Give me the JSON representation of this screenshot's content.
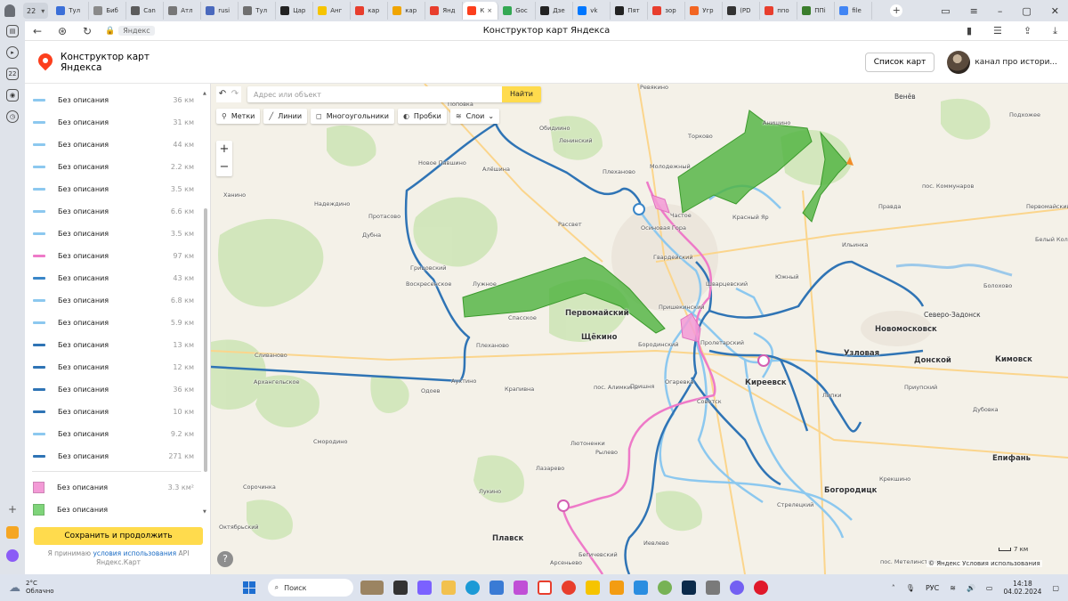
{
  "browser": {
    "tab_counter": "22",
    "tabs": [
      {
        "label": "Тул",
        "color": "#3b6fd8"
      },
      {
        "label": "Биб",
        "color": "#8a8a8a"
      },
      {
        "label": "Сan",
        "color": "#5c5c5c"
      },
      {
        "label": "Атл",
        "color": "#777777"
      },
      {
        "label": "rusi",
        "color": "#4a69bd"
      },
      {
        "label": "Тул",
        "color": "#6f6f6f"
      },
      {
        "label": "Цар",
        "color": "#222222"
      },
      {
        "label": "Анг",
        "color": "#f6c400"
      },
      {
        "label": "кар",
        "color": "#e83e2d"
      },
      {
        "label": "кар",
        "color": "#f0a500"
      },
      {
        "label": "Янд",
        "color": "#e83e2d"
      },
      {
        "label": "К",
        "color": "#fc3f1d",
        "active": true
      },
      {
        "label": "Goc",
        "color": "#34a853"
      },
      {
        "label": "Дзе",
        "color": "#222222"
      },
      {
        "label": "vk",
        "color": "#0077ff"
      },
      {
        "label": "Пят",
        "color": "#222222"
      },
      {
        "label": "зор",
        "color": "#e83e2d"
      },
      {
        "label": "Угр",
        "color": "#f26522"
      },
      {
        "label": "(PD",
        "color": "#333333"
      },
      {
        "label": "ппо",
        "color": "#e83e2d"
      },
      {
        "label": "ППі",
        "color": "#3a7d2c"
      },
      {
        "label": "file",
        "color": "#4285f4"
      }
    ],
    "address_domain": "Яндекс",
    "page_title": "Конструктор карт Яндекса"
  },
  "app": {
    "title_line1": "Конструктор карт",
    "title_line2": "Яндекса",
    "list_button": "Список карт",
    "channel": "канал про истори..."
  },
  "sidebar": {
    "objects": [
      {
        "name": "Без описания",
        "value": "36 км",
        "type": "line",
        "color": "#8cc8ef"
      },
      {
        "name": "Без описания",
        "value": "31 км",
        "type": "line",
        "color": "#8cc8ef"
      },
      {
        "name": "Без описания",
        "value": "44 км",
        "type": "line",
        "color": "#8cc8ef"
      },
      {
        "name": "Без описания",
        "value": "2.2 км",
        "type": "line",
        "color": "#8cc8ef"
      },
      {
        "name": "Без описания",
        "value": "3.5 км",
        "type": "line",
        "color": "#8cc8ef"
      },
      {
        "name": "Без описания",
        "value": "6.6 км",
        "type": "line",
        "color": "#8cc8ef"
      },
      {
        "name": "Без описания",
        "value": "3.5 км",
        "type": "line",
        "color": "#8cc8ef"
      },
      {
        "name": "Без описания",
        "value": "97 км",
        "type": "line",
        "color": "#ee7ac8"
      },
      {
        "name": "Без описания",
        "value": "43 км",
        "type": "line",
        "color": "#3a86c8"
      },
      {
        "name": "Без описания",
        "value": "6.8 км",
        "type": "line",
        "color": "#8cc8ef"
      },
      {
        "name": "Без описания",
        "value": "5.9 км",
        "type": "line",
        "color": "#8cc8ef"
      },
      {
        "name": "Без описания",
        "value": "13 км",
        "type": "line",
        "color": "#2f74b5"
      },
      {
        "name": "Без описания",
        "value": "12 км",
        "type": "line",
        "color": "#2f74b5"
      },
      {
        "name": "Без описания",
        "value": "36 км",
        "type": "line",
        "color": "#2f74b5"
      },
      {
        "name": "Без описания",
        "value": "10 км",
        "type": "line",
        "color": "#2f74b5"
      },
      {
        "name": "Без описания",
        "value": "9.2 км",
        "type": "line",
        "color": "#8cc8ef"
      },
      {
        "name": "Без описания",
        "value": "271 км",
        "type": "line",
        "color": "#2f74b5"
      }
    ],
    "polygons": [
      {
        "name": "Без описания",
        "value": "3.3 км²",
        "color": "#f39ad6"
      },
      {
        "name": "Без описания",
        "value": "",
        "color": "#7fd47a"
      }
    ],
    "save_button": "Сохранить и продолжить",
    "terms_prefix": "Я принимаю ",
    "terms_link": "условия использования",
    "terms_suffix": " API Яндекс.Карт"
  },
  "map_controls": {
    "search_placeholder": "Адрес или объект",
    "find_button": "Найти",
    "tools": [
      "Метки",
      "Линии",
      "Многоугольники",
      "Пробки",
      "Слои"
    ],
    "zoom_in": "+",
    "zoom_out": "−",
    "help": "?",
    "scale": "7 км",
    "copyright": "© Яндекс",
    "terms_link": "Условия использования"
  },
  "map_labels": {
    "big": [
      "Первомайский",
      "Щёкино",
      "Новомосковск",
      "Кимовск",
      "Донской",
      "Узловая",
      "Богородицк",
      "Киреевск",
      "Плавск",
      "Епифань"
    ],
    "mid": [
      "Венёв",
      "Северо-Задонск"
    ],
    "small": [
      "Ревякино",
      "Поповка",
      "Обидиино",
      "Ленинский",
      "Торково",
      "Анишино",
      "Подхожее",
      "Новое Павшино",
      "Алёшина",
      "Плеханово",
      "Молодежный",
      "Ханино",
      "Надеждино",
      "Протасово",
      "Рассвет",
      "Осиновая Гора",
      "Частое",
      "Красный Яр",
      "пос. Коммунаров",
      "Правда",
      "Первомайский",
      "Дубна",
      "Гвардейский",
      "Ильинка",
      "Грицовский",
      "Воскресенское",
      "Лужное",
      "Южный",
      "Шварцевский",
      "Болохово",
      "Спасское",
      "Пришекинский",
      "Пролетарский",
      "Бородинский",
      "Плеханово",
      "Сливаново",
      "Архангельское",
      "Аухтино",
      "Одоев",
      "Крапивна",
      "пос. Алимкина",
      "Пришня",
      "Огаревка",
      "Советск",
      "Липки",
      "Приупский",
      "Дубовка",
      "Смородино",
      "Лютоненки",
      "Рылево",
      "Лазарево",
      "Сорочинка",
      "Лукино",
      "Стрелецкий",
      "Крекшино",
      "Октябрьский",
      "Иевлево",
      "Бегичевский",
      "Арсеньево",
      "пос. Метелинсторов",
      "Белый Колодезь",
      "Сорочинка",
      "Товарковский",
      "Мокрое",
      "Гремячее"
    ]
  },
  "taskbar": {
    "temperature": "2°C",
    "weather": "Облачно",
    "search": "Поиск",
    "lang": "РУС",
    "time": "14:18",
    "date": "04.02.2024"
  },
  "colors": {
    "light_blue_line": "#8cc8ef",
    "dark_blue_line": "#2f74b5",
    "pink_line": "#ee7ac8",
    "green_fill": "#4db33d",
    "pink_fill": "#f39ad6",
    "accent_yellow": "#ffdb4d"
  }
}
